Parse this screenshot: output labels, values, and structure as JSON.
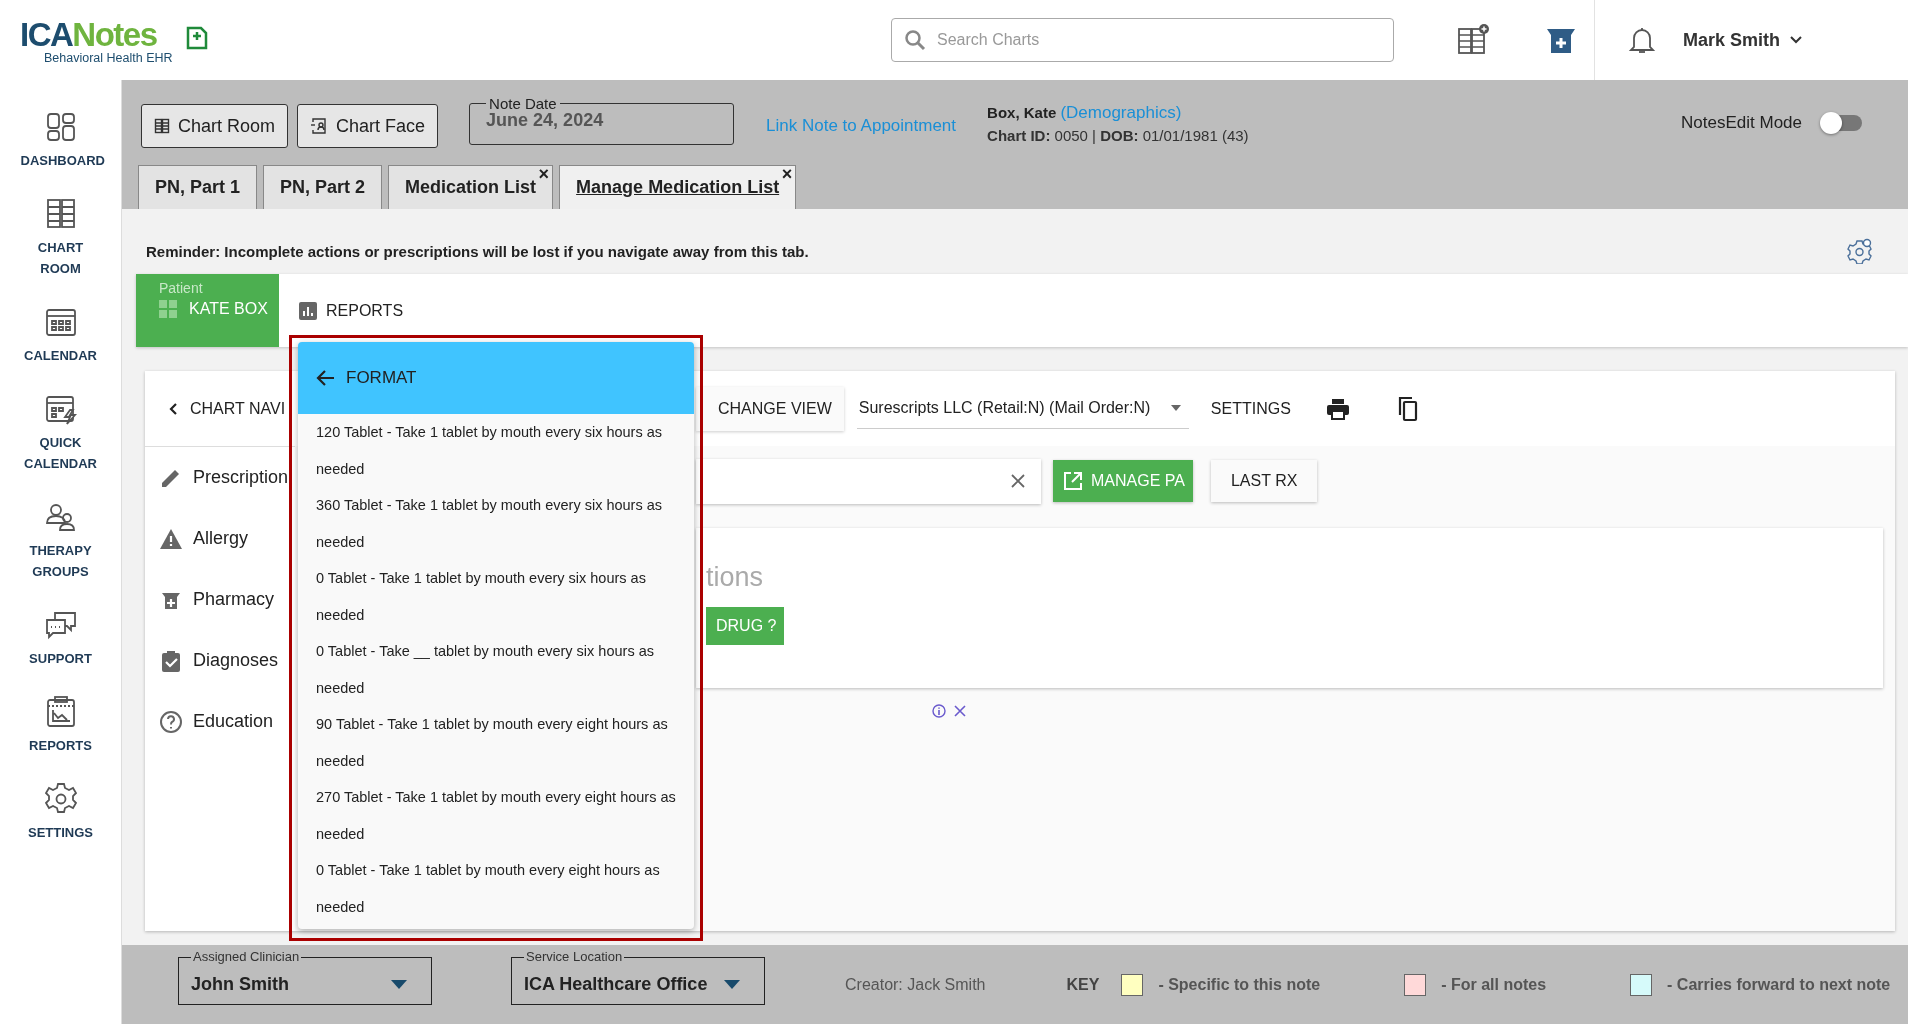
{
  "topbar": {
    "logo": {
      "parts": [
        "ICA",
        "Notes"
      ],
      "subtitle": "Behavioral Health EHR"
    },
    "search": {
      "placeholder": "Search Charts"
    },
    "user": "Mark Smith"
  },
  "sidebar": {
    "items": [
      {
        "label": "DASHBOARD",
        "kind": "dashboard"
      },
      {
        "label": "CHART ROOM",
        "kind": "cabinet"
      },
      {
        "label": "CALENDAR",
        "kind": "calendar"
      },
      {
        "label": "QUICK CALENDAR",
        "kind": "quick"
      },
      {
        "label": "THERAPY GROUPS",
        "kind": "people"
      },
      {
        "label": "SUPPORT",
        "kind": "chat"
      },
      {
        "label": "REPORTS",
        "kind": "report"
      },
      {
        "label": "SETTINGS",
        "kind": "gear"
      }
    ]
  },
  "note_header": {
    "buttons": [
      {
        "label": "Chart Room",
        "kind": "cabinet"
      },
      {
        "label": "Chart Face",
        "kind": "face"
      }
    ],
    "note_date": {
      "label": "Note Date",
      "value": "June 24, 2024"
    },
    "link": "Link Note to Appointment",
    "patient": {
      "name": "Box, Kate",
      "demographics": "(Demographics)",
      "details": "**Chart ID:** 0050 | **DOB:** 01/01/1981 (43)"
    },
    "notes_edit_mode": {
      "label": "NotesEdit Mode",
      "on": false
    }
  },
  "tabs": [
    {
      "label": "PN, Part 1",
      "selected": false
    },
    {
      "label": "PN, Part 2",
      "selected": false
    },
    {
      "label": "Medication List",
      "selected": false,
      "close": "×"
    },
    {
      "label": "Manage Medication List",
      "selected": true,
      "close": "×"
    }
  ],
  "reminder": "Reminder: Incomplete actions or prescriptions will be lost if you navigate away from this tab.",
  "patient_bar": {
    "caption": "Patient",
    "name": "KATE BOX",
    "reports": "REPORTS"
  },
  "chart_nav": {
    "title": "CHART NAVI",
    "items": [
      {
        "label": "Prescription",
        "kind": "pencil"
      },
      {
        "label": "Allergy",
        "kind": "warning"
      },
      {
        "label": "Pharmacy",
        "kind": "pharmacy"
      },
      {
        "label": "Diagnoses",
        "kind": "clipboard"
      },
      {
        "label": "Education",
        "kind": "help"
      }
    ]
  },
  "toolbar": {
    "change_view": "CHANGE VIEW",
    "pharmacy": "Surescripts LLC (Retail:N) (Mail Order:N)",
    "settings": "SETTINGS"
  },
  "actions": {
    "manage_pa": "MANAGE PA",
    "last_rx": "LAST RX"
  },
  "panel": {
    "heading": "tions",
    "button": "DRUG ?"
  },
  "format_menu": {
    "title": "FORMAT",
    "options": [
      "120 Tablet - Take 1 tablet by mouth every six hours as needed",
      "360 Tablet - Take 1 tablet by mouth every six hours as needed",
      "0 Tablet - Take 1 tablet by mouth every six hours as needed",
      "0 Tablet - Take __ tablet by mouth every six hours as needed",
      "90 Tablet - Take 1 tablet by mouth every eight hours as needed",
      "270 Tablet - Take 1 tablet by mouth every eight hours as needed",
      "0 Tablet - Take 1 tablet by mouth every eight hours as needed"
    ]
  },
  "footer": {
    "fields": [
      {
        "label": "Assigned Clinician",
        "value": "John Smith"
      },
      {
        "label": "Service Location",
        "value": "ICA Healthcare Office"
      }
    ],
    "creator": "Creator: Jack Smith",
    "key_label": "KEY",
    "key": [
      {
        "label": "- Specific to this note",
        "color": "#ffffc0"
      },
      {
        "label": "- For all notes",
        "color": "#ffd9d9"
      },
      {
        "label": "- Carries forward to next note",
        "color": "#d6fafa"
      }
    ]
  }
}
